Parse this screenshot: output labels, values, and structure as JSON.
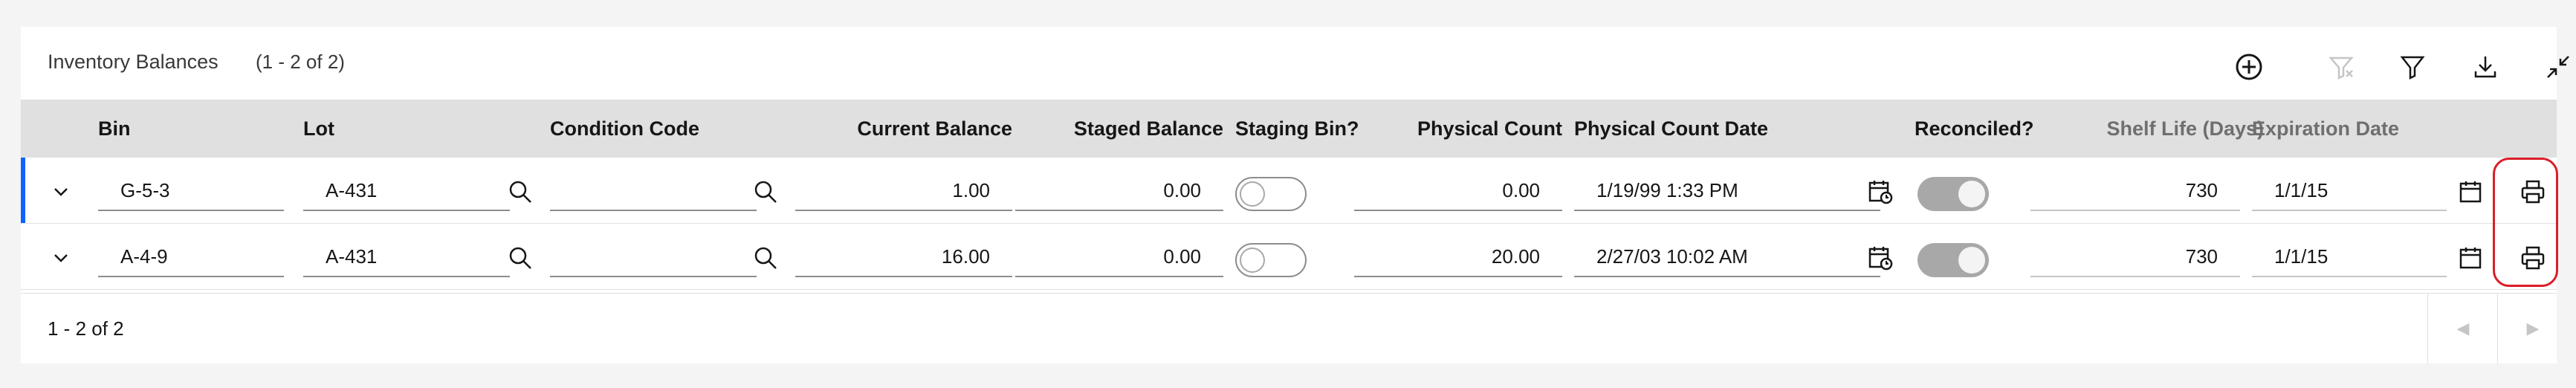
{
  "table": {
    "title": "Inventory Balances",
    "count": "(1 - 2 of 2)",
    "columns": {
      "bin": "Bin",
      "lot": "Lot",
      "condition_code": "Condition Code",
      "current_balance": "Current Balance",
      "staged_balance": "Staged Balance",
      "staging_bin": "Staging Bin?",
      "physical_count": "Physical Count",
      "physical_count_date": "Physical Count Date",
      "reconciled": "Reconciled?",
      "shelf_life": "Shelf Life (Days)",
      "expiration_date": "Expiration Date"
    },
    "rows": [
      {
        "bin": "G-5-3",
        "lot": "A-431",
        "condition_code": "",
        "current_balance": "1.00",
        "staged_balance": "0.00",
        "staging_bin": false,
        "physical_count": "0.00",
        "physical_count_date": "1/19/99 1:33 PM",
        "reconciled": true,
        "shelf_life": "730",
        "expiration_date": "1/1/15"
      },
      {
        "bin": "A-4-9",
        "lot": "A-431",
        "condition_code": "",
        "current_balance": "16.00",
        "staged_balance": "0.00",
        "staging_bin": false,
        "physical_count": "20.00",
        "physical_count_date": "2/27/03 10:02 AM",
        "reconciled": true,
        "shelf_life": "730",
        "expiration_date": "1/1/15"
      }
    ],
    "pagination": "1 - 2 of 2"
  },
  "toolbar_icons": [
    "add-circle-icon",
    "clear-filter-icon",
    "filter-icon",
    "download-icon",
    "collapse-icon"
  ],
  "colors": {
    "accent": "#0f62fe",
    "highlight": "#da1e28",
    "header_bg": "#e0e0e0",
    "page_bg": "#f4f4f4"
  }
}
